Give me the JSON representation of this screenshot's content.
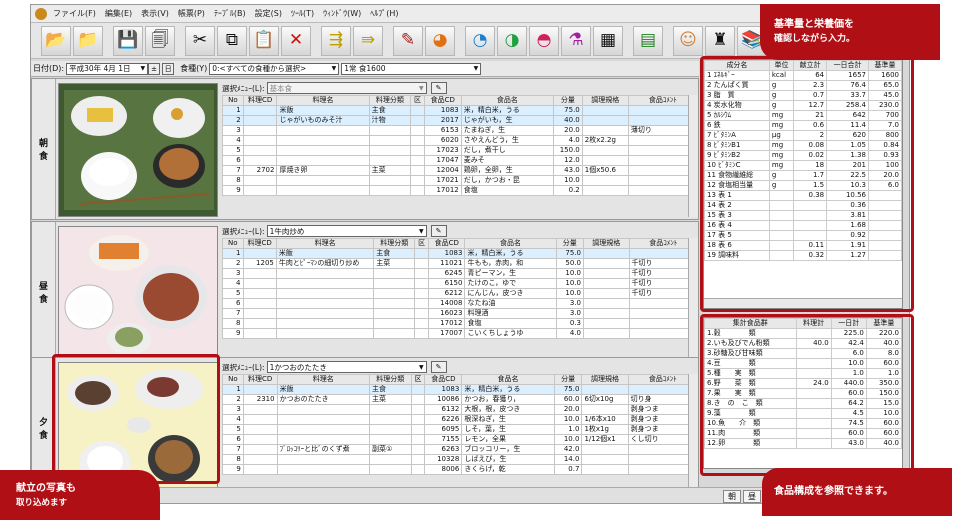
{
  "menu": [
    "ファイル(F)",
    "編集(E)",
    "表示(V)",
    "帳票(P)",
    "ﾃｰﾌﾞﾙ(B)",
    "設定(S)",
    "ﾂｰﾙ(T)",
    "ｳｨﾝﾄﾞｳ(W)",
    "ﾍﾙﾌﾟ(H)"
  ],
  "toolbar_icons": [
    "folder-open-icon",
    "open-icon",
    "save-icon",
    "print-preview-icon",
    "cut-icon",
    "copy-icon",
    "paste-icon",
    "delete-icon",
    "insert-row-icon",
    "append-icon",
    "edit-icon",
    "chart-icon",
    "pie-chart-icon",
    "compare-icon",
    "bar-icon",
    "nutrient-icon",
    "calendar-icon",
    "grid-icon",
    "person-icon",
    "group-icon",
    "books-icon"
  ],
  "datebar": {
    "date_label": "日付(D):",
    "date_value": "平成30年 4月 1日",
    "today": "日",
    "meal_type_label": "食種(Y)",
    "meal_type_value": "0:<すべての食種から選択>",
    "meal_value": "1常 食1600"
  },
  "meal_labels": {
    "breakfast": [
      "朝",
      "食"
    ],
    "lunch": [
      "昼",
      "食"
    ],
    "dinner": [
      "夕",
      "食"
    ]
  },
  "columns": [
    "No",
    "料理CD",
    "料理名",
    "料理分類",
    "区",
    "食品CD",
    "食品名",
    "分量",
    "調理規格",
    "食品ｺﾒﾝﾄ"
  ],
  "breakfast": {
    "select_label": "選択ﾒﾆｭｰ(L):",
    "select_value": "基本食",
    "rows": [
      [
        "1",
        "",
        "米飯",
        "主食",
        "",
        "1083",
        "米，精白米，うる",
        "75.0",
        "",
        ""
      ],
      [
        "2",
        "",
        "じゃがいものみそ汁",
        "汁物",
        "",
        "2017",
        "じゃがいも，生",
        "40.0",
        "",
        ""
      ],
      [
        "3",
        "",
        "",
        "",
        "",
        "6153",
        "たまねぎ，生",
        "20.0",
        "",
        "薄切り"
      ],
      [
        "4",
        "",
        "",
        "",
        "",
        "6020",
        "さやえんどう，生",
        "4.0",
        "2枚x2.2g",
        ""
      ],
      [
        "5",
        "",
        "",
        "",
        "",
        "17023",
        "だし，煮干し",
        "150.0",
        "",
        ""
      ],
      [
        "6",
        "",
        "",
        "",
        "",
        "17047",
        "麦みそ",
        "12.0",
        "",
        ""
      ],
      [
        "7",
        "2702",
        "厚焼き卵",
        "主菜",
        "",
        "12004",
        "鶏卵，全卵，生",
        "43.0",
        "1個x50.6",
        ""
      ],
      [
        "8",
        "",
        "",
        "",
        "",
        "17021",
        "だし，かつお・昆",
        "10.0",
        "",
        ""
      ],
      [
        "9",
        "",
        "",
        "",
        "",
        "17012",
        "食塩",
        "0.2",
        "",
        ""
      ]
    ]
  },
  "lunch": {
    "select_label": "選択ﾒﾆｭｰ(L):",
    "select_value": "1牛肉炒め",
    "rows": [
      [
        "1",
        "",
        "米飯",
        "主食",
        "",
        "1083",
        "米，精白米，うる",
        "75.0",
        "",
        ""
      ],
      [
        "2",
        "1205",
        "牛肉とﾋﾟｰﾏﾝの細切り炒め",
        "主菜",
        "",
        "11021",
        "牛もも，赤肉，和",
        "50.0",
        "",
        "千切り"
      ],
      [
        "3",
        "",
        "",
        "",
        "",
        "6245",
        "青ピーマン，生",
        "10.0",
        "",
        "千切り"
      ],
      [
        "4",
        "",
        "",
        "",
        "",
        "6150",
        "たけのこ，ゆで",
        "10.0",
        "",
        "千切り"
      ],
      [
        "5",
        "",
        "",
        "",
        "",
        "6212",
        "にんじん，皮つき",
        "10.0",
        "",
        "千切り"
      ],
      [
        "6",
        "",
        "",
        "",
        "",
        "14008",
        "なたね油",
        "3.0",
        "",
        ""
      ],
      [
        "7",
        "",
        "",
        "",
        "",
        "16023",
        "料理酒",
        "3.0",
        "",
        ""
      ],
      [
        "8",
        "",
        "",
        "",
        "",
        "17012",
        "食塩",
        "0.3",
        "",
        ""
      ],
      [
        "9",
        "",
        "",
        "",
        "",
        "17007",
        "こいくちしょうゆ",
        "4.0",
        "",
        ""
      ]
    ]
  },
  "dinner": {
    "select_label": "選択ﾒﾆｭｰ(L):",
    "select_value": "1かつおのたたき",
    "rows": [
      [
        "1",
        "",
        "米飯",
        "主食",
        "",
        "1083",
        "米，精白米，うる",
        "75.0",
        "",
        ""
      ],
      [
        "2",
        "2310",
        "かつおのたたき",
        "主菜",
        "",
        "10086",
        "かつお，春獲り，",
        "60.0",
        "6切x10g",
        "切り身"
      ],
      [
        "3",
        "",
        "",
        "",
        "",
        "6132",
        "大根，根，皮つき",
        "20.0",
        "",
        "剥身つま"
      ],
      [
        "4",
        "",
        "",
        "",
        "",
        "6226",
        "根深ねぎ，生",
        "10.0",
        "1/6本x10",
        "剥身つま"
      ],
      [
        "5",
        "",
        "",
        "",
        "",
        "6095",
        "しそ，葉，生",
        "1.0",
        "1枚x1g",
        "剥身つま"
      ],
      [
        "6",
        "",
        "",
        "",
        "",
        "7155",
        "レモン，全果",
        "10.0",
        "1/12個x1",
        "くし切り"
      ],
      [
        "7",
        "",
        "ﾌﾞﾛｯｺﾘｰと比ﾞのくず煮",
        "副菜①",
        "",
        "6263",
        "ブロッコリー，生",
        "42.0",
        "",
        ""
      ],
      [
        "8",
        "",
        "",
        "",
        "",
        "10328",
        "しばえび，生",
        "14.0",
        "",
        ""
      ],
      [
        "9",
        "",
        "",
        "",
        "",
        "8006",
        "きくらげ，乾",
        "0.7",
        "",
        ""
      ]
    ]
  },
  "nutrition": {
    "columns": [
      "成分名",
      "単位",
      "献立計",
      "一日合計",
      "基準量"
    ],
    "rows": [
      [
        "1 ｴﾈﾙｷﾞｰ",
        "kcal",
        "64",
        "1657",
        "1600"
      ],
      [
        "2 たんぱく質",
        "g",
        "2.3",
        "76.4",
        "65.0"
      ],
      [
        "3 脂　質",
        "g",
        "0.7",
        "33.7",
        "45.0"
      ],
      [
        "4 炭水化物",
        "g",
        "12.7",
        "258.4",
        "230.0"
      ],
      [
        "5 ｶﾙｼｳﾑ",
        "mg",
        "21",
        "642",
        "700"
      ],
      [
        "6 鉄",
        "mg",
        "0.6",
        "11.4",
        "7.0"
      ],
      [
        "7 ﾋﾞﾀﾐﾝA",
        "μg",
        "2",
        "620",
        "800"
      ],
      [
        "8 ﾋﾞﾀﾐﾝB1",
        "mg",
        "0.08",
        "1.05",
        "0.84"
      ],
      [
        "9 ﾋﾞﾀﾐﾝB2",
        "mg",
        "0.02",
        "1.38",
        "0.93"
      ],
      [
        "10 ﾋﾞﾀﾐﾝC",
        "mg",
        "18",
        "201",
        "100"
      ],
      [
        "11 食物繊維総",
        "g",
        "1.7",
        "22.5",
        "20.0"
      ],
      [
        "12 食塩相当量",
        "g",
        "1.5",
        "10.3",
        "6.0"
      ],
      [
        "13 表 1",
        "",
        "0.38",
        "10.56",
        ""
      ],
      [
        "14 表 2",
        "",
        "",
        "0.36",
        ""
      ],
      [
        "15 表 3",
        "",
        "",
        "3.81",
        ""
      ],
      [
        "16 表 4",
        "",
        "",
        "1.68",
        ""
      ],
      [
        "17 表 5",
        "",
        "",
        "0.92",
        ""
      ],
      [
        "18 表 6",
        "",
        "0.11",
        "1.91",
        ""
      ],
      [
        "19 調味料",
        "",
        "0.32",
        "1.27",
        ""
      ]
    ]
  },
  "food_groups": {
    "columns": [
      "集計食品群",
      "料理計",
      "一日計",
      "基準量"
    ],
    "rows": [
      [
        "1.穀　　　　類",
        "",
        "225.0",
        "220.0"
      ],
      [
        "2.いも及びでん粉類",
        "40.0",
        "42.4",
        "40.0"
      ],
      [
        "3.砂糖及び甘味類",
        "",
        "6.0",
        "8.0"
      ],
      [
        "4.豆　　　　類",
        "",
        "10.0",
        "60.0"
      ],
      [
        "5.種　　実　類",
        "",
        "1.0",
        "1.0"
      ],
      [
        "6.野　　菜　類",
        "24.0",
        "440.0",
        "350.0"
      ],
      [
        "7.果　　実　類",
        "",
        "60.0",
        "150.0"
      ],
      [
        "8.き　の　こ　類",
        "",
        "64.2",
        "15.0"
      ],
      [
        "9.藻　　　　類",
        "",
        "4.5",
        "10.0"
      ],
      [
        "10.魚　　介　類",
        "",
        "74.5",
        "60.0"
      ],
      [
        "11.肉　　　　類",
        "",
        "60.0",
        "60.0"
      ],
      [
        "12.卵　　　　類",
        "",
        "43.0",
        "40.0"
      ]
    ]
  },
  "bottom_tabs": [
    "朝",
    "昼"
  ],
  "callouts": {
    "top_right_line1": "基準量と栄養価を",
    "top_right_line2": "確認しながら入力。",
    "bottom_left_line1": "献立の写真も",
    "bottom_left_line2": "取り込めます",
    "bottom_right": "食品構成を参照できます。"
  },
  "colors": {
    "accent": "#b01015",
    "highlight_row": "#dcefff"
  }
}
